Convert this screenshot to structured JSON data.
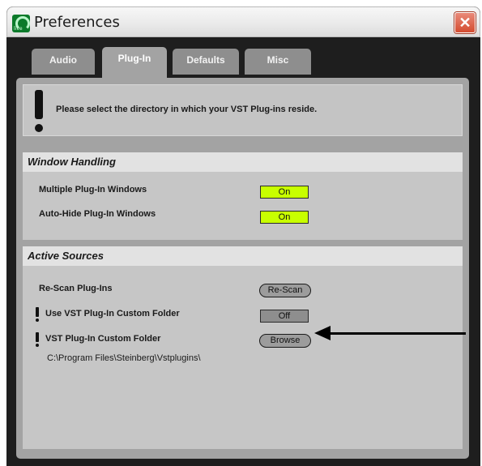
{
  "window": {
    "title": "Preferences",
    "app_icon_label": "live"
  },
  "tabs": [
    {
      "label": "Audio",
      "active": false
    },
    {
      "label": "Plug-In",
      "active": true
    },
    {
      "label": "Defaults",
      "active": false
    },
    {
      "label": "Misc",
      "active": false
    }
  ],
  "notice": {
    "text": "Please select the directory in which your VST Plug-ins reside."
  },
  "window_handling": {
    "title": "Window Handling",
    "multiple_windows": {
      "label": "Multiple Plug-In Windows",
      "value": "On"
    },
    "auto_hide": {
      "label": "Auto-Hide Plug-In Windows",
      "value": "On"
    }
  },
  "active_sources": {
    "title": "Active Sources",
    "rescan": {
      "label": "Re-Scan Plug-Ins",
      "button": "Re-Scan"
    },
    "use_custom_folder": {
      "label": "Use VST Plug-In Custom Folder",
      "value": "Off"
    },
    "custom_folder": {
      "label": "VST Plug-In Custom Folder",
      "button": "Browse"
    },
    "path": "C:\\Program Files\\Steinberg\\Vstplugins\\"
  },
  "colors": {
    "toggle_on": "#c8ff00",
    "toggle_off": "#8e8e8e",
    "window_bg": "#1e1e1e",
    "panel_bg": "#a3a3a3"
  }
}
